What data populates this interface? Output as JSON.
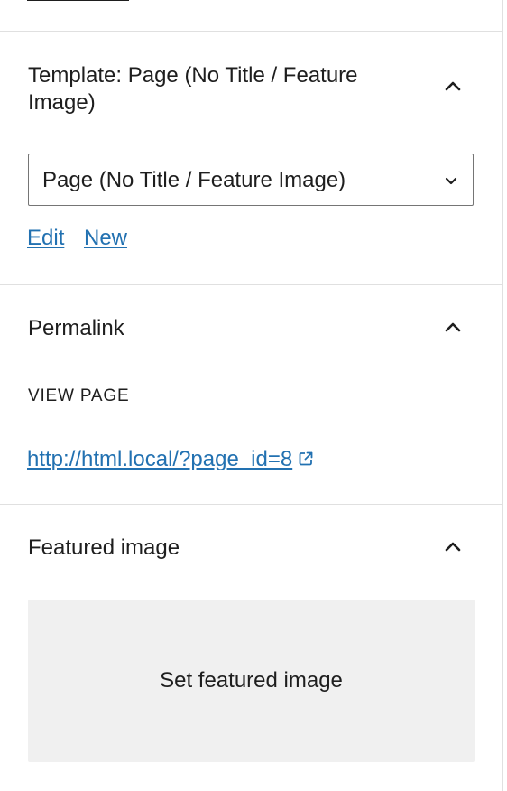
{
  "template_panel": {
    "title": "Template: Page (No Title / Feature Image)",
    "toggle_icon": "chevron-up-icon",
    "select_value": "Page (No Title / Feature Image)",
    "select_icon": "chevron-down-icon",
    "edit_link": "Edit",
    "new_link": "New"
  },
  "permalink_panel": {
    "title": "Permalink",
    "toggle_icon": "chevron-up-icon",
    "view_label": "VIEW PAGE",
    "url": "http://html.local/?page_id=8",
    "external_icon": "external-link-icon"
  },
  "featured_panel": {
    "title": "Featured image",
    "toggle_icon": "chevron-up-icon",
    "set_button": "Set featured image"
  },
  "colors": {
    "link": "#2271b1",
    "text": "#1e1e1e",
    "border": "#e0e0e0",
    "placeholder_bg": "#f0f0f0"
  }
}
